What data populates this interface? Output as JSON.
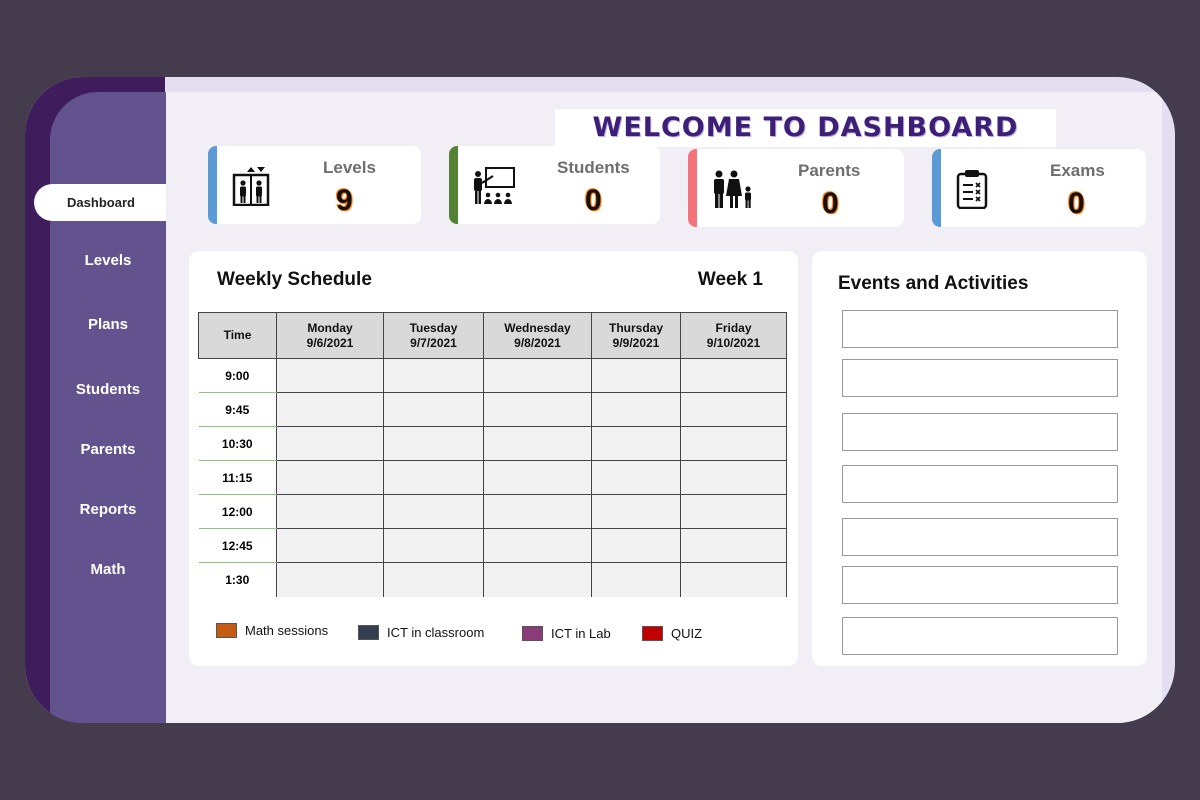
{
  "header": {
    "title": "WELCOME TO DASHBOARD"
  },
  "sidebar": {
    "items": [
      {
        "label": "Dashboard",
        "active": true
      },
      {
        "label": "Levels"
      },
      {
        "label": "Plans"
      },
      {
        "label": "Students"
      },
      {
        "label": "Parents"
      },
      {
        "label": "Reports"
      },
      {
        "label": "Math"
      }
    ]
  },
  "stats": [
    {
      "label": "Levels",
      "value": "9",
      "icon": "elevator-icon",
      "color": "#5b9bd5"
    },
    {
      "label": "Students",
      "value": "0",
      "icon": "classroom-icon",
      "color": "#548235"
    },
    {
      "label": "Parents",
      "value": "0",
      "icon": "family-icon",
      "color": "#f4747a"
    },
    {
      "label": "Exams",
      "value": "0",
      "icon": "clipboard-icon",
      "color": "#5b9bd5"
    }
  ],
  "schedule": {
    "title": "Weekly Schedule",
    "week": "Week 1",
    "time_header": "Time",
    "days": [
      {
        "name": "Monday",
        "date": "9/6/2021"
      },
      {
        "name": "Tuesday",
        "date": "9/7/2021"
      },
      {
        "name": "Wednesday",
        "date": "9/8/2021"
      },
      {
        "name": "Thursday",
        "date": "9/9/2021"
      },
      {
        "name": "Friday",
        "date": "9/10/2021"
      }
    ],
    "times": [
      "9:00",
      "9:45",
      "10:30",
      "11:15",
      "12:00",
      "12:45",
      "1:30"
    ],
    "legend": [
      {
        "label": "Math sessions",
        "color": "#c55a11"
      },
      {
        "label": "ICT in classroom",
        "color": "#333f50"
      },
      {
        "label": "ICT in Lab",
        "color": "#8b3b7a"
      },
      {
        "label": "QUIZ",
        "color": "#c00000"
      }
    ]
  },
  "events": {
    "title": "Events and Activities"
  },
  "colors": {
    "accent": "#3d1f78",
    "sidebar": "#62538f",
    "value_glow": "#ff7a00"
  }
}
